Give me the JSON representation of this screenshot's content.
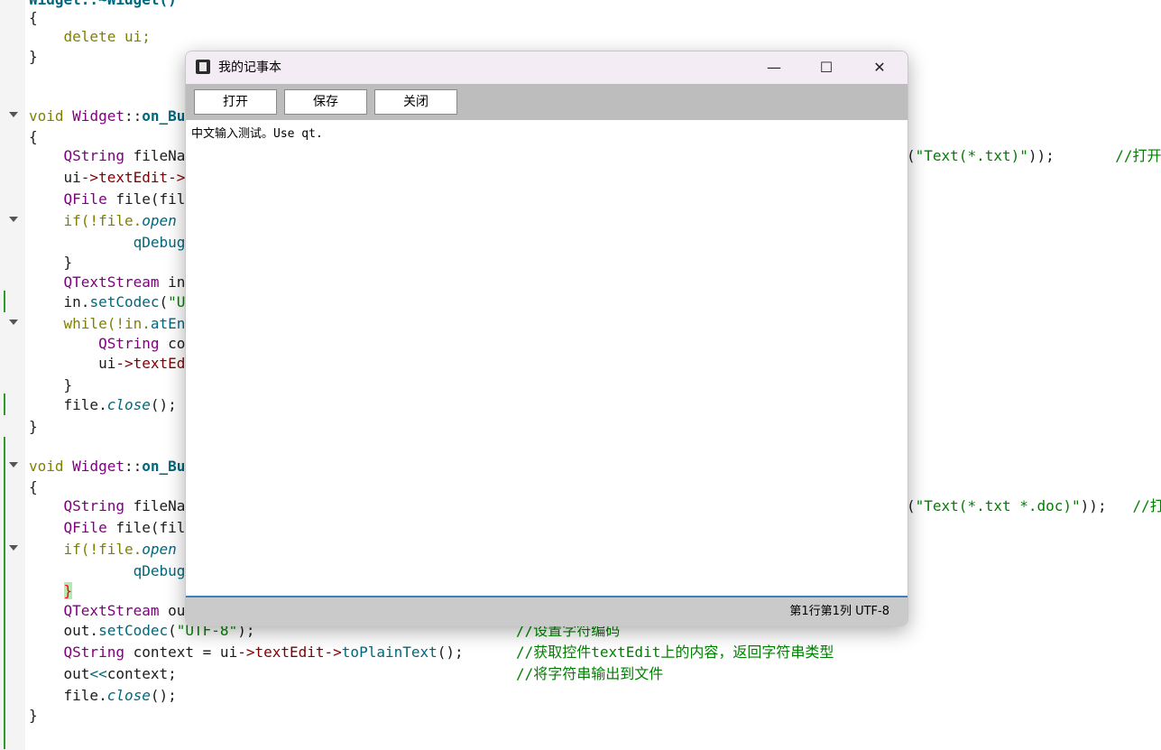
{
  "code_lines": {
    "l0": [
      "Widget::~Widget()"
    ],
    "l1": [
      "{"
    ],
    "l2": [
      "    delete ui;"
    ],
    "l3": [
      "}"
    ],
    "l4": [
      "void ",
      "Widget",
      "::",
      "on_Bu"
    ],
    "l5": [
      "{"
    ],
    "l6": [
      "    ",
      "QString",
      " fileNa"
    ],
    "l6r": [
      "(",
      "\"Text(*.txt)\"",
      "));       ",
      "//打开"
    ],
    "l7": [
      "    ui",
      "->",
      "textEdit",
      "->"
    ],
    "l8": [
      "    ",
      "QFile",
      " file(fil"
    ],
    "l9": [
      "    if(!file.",
      "open"
    ],
    "l10": [
      "            ",
      "qDebug"
    ],
    "l11": [
      "    }"
    ],
    "l12": [
      "    ",
      "QTextStream",
      " in"
    ],
    "l13": [
      "    in.",
      "setCodec",
      "(",
      "\"U"
    ],
    "l14": [
      "    while(!in.",
      "atEn"
    ],
    "l15": [
      "        ",
      "QString",
      " co"
    ],
    "l16": [
      "        ui",
      "->",
      "textEd"
    ],
    "l17": [
      "    }"
    ],
    "l18": [
      "    file.",
      "close",
      "();"
    ],
    "l19": [
      "}"
    ],
    "l20": [
      "void ",
      "Widget",
      "::",
      "on_Bu"
    ],
    "l21": [
      "{"
    ],
    "l22": [
      "    ",
      "QString",
      " fileNa"
    ],
    "l22r": [
      "(",
      "\"Text(*.txt *.doc)\"",
      "));   ",
      "//打"
    ],
    "l23": [
      "    ",
      "QFile",
      " file(fil"
    ],
    "l24": [
      "    if(!file.",
      "open"
    ],
    "l25": [
      "            ",
      "qDebug"
    ],
    "l26": [
      "    ",
      "}"
    ],
    "l27": [
      "    ",
      "QTextStream",
      " ou"
    ],
    "l28": [
      "    out.",
      "setCodec",
      "(",
      "\"UTF-8\"",
      ");",
      "//设置字符编码"
    ],
    "l29": [
      "    ",
      "QString",
      " context = ui",
      "->",
      "textEdit",
      "->",
      "toPlainText",
      "();",
      "//获取控件textEdit上的内容，返回字符串类型"
    ],
    "l30": [
      "    out",
      "<<",
      "context;",
      "//将字符串输出到文件"
    ],
    "l31": [
      "    file.",
      "close",
      "();"
    ],
    "l32": [
      "}"
    ]
  },
  "window": {
    "title": "我的记事本",
    "minimize_glyph": "—",
    "maximize_glyph": "☐",
    "close_glyph": "✕",
    "buttons": {
      "open": "打开",
      "save": "保存",
      "close": "关闭"
    },
    "editor_text": "中文输入测试。Use qt.",
    "status_position": "第1行第1列",
    "status_encoding": "UTF-8"
  },
  "colors": {
    "toolbar": "#bdbdbd",
    "statusbar": "#cacaca",
    "titlebar": "#f4ecf4",
    "editor_focus": "#3d7fc4",
    "comment": "#008000",
    "keyword": "#808000"
  }
}
